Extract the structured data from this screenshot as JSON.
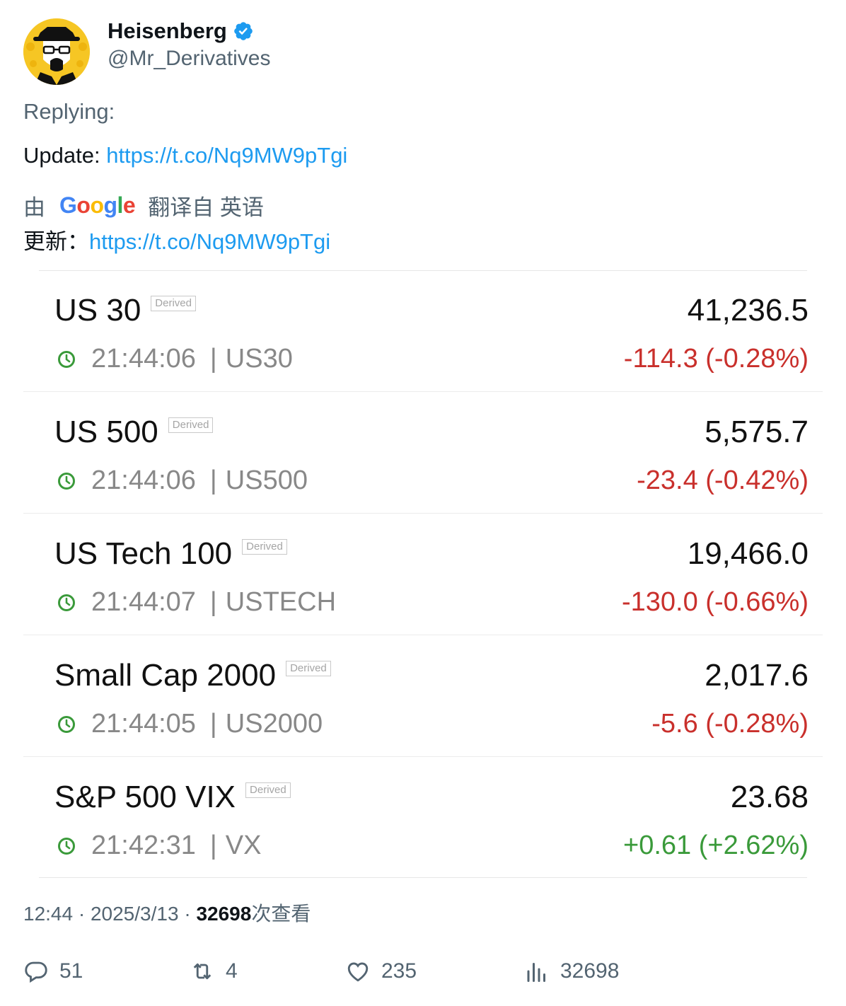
{
  "user": {
    "display_name": "Heisenberg",
    "handle": "@Mr_Derivatives"
  },
  "tweet": {
    "replying_label": "Replying:",
    "text_prefix": "Update: ",
    "text_link": "https://t.co/Nq9MW9pTgi",
    "translated_by_prefix": "由",
    "translated_by_suffix": "翻译自 英语",
    "translated_text_prefix": "更新：",
    "translated_text_link": "https://t.co/Nq9MW9pTgi"
  },
  "google_logo_letters": [
    "G",
    "o",
    "o",
    "g",
    "l",
    "e"
  ],
  "google_logo_colors": [
    "#4285F4",
    "#EA4335",
    "#FBBC05",
    "#4285F4",
    "#34A853",
    "#EA4335"
  ],
  "quotes": [
    {
      "name": "US 30",
      "badge": "Derived",
      "price": "41,236.5",
      "time": "21:44:06",
      "symbol": "US30",
      "change": "-114.3 (-0.28%)",
      "direction": "neg"
    },
    {
      "name": "US 500",
      "badge": "Derived",
      "price": "5,575.7",
      "time": "21:44:06",
      "symbol": "US500",
      "change": "-23.4 (-0.42%)",
      "direction": "neg"
    },
    {
      "name": "US Tech 100",
      "badge": "Derived",
      "price": "19,466.0",
      "time": "21:44:07",
      "symbol": "USTECH",
      "change": "-130.0 (-0.66%)",
      "direction": "neg"
    },
    {
      "name": "Small Cap 2000",
      "badge": "Derived",
      "price": "2,017.6",
      "time": "21:44:05",
      "symbol": "US2000",
      "change": "-5.6 (-0.28%)",
      "direction": "neg"
    },
    {
      "name": "S&P 500 VIX",
      "badge": "Derived",
      "price": "23.68",
      "time": "21:42:31",
      "symbol": "VX",
      "change": "+0.61 (+2.62%)",
      "direction": "pos"
    }
  ],
  "meta": {
    "time": "12:44",
    "separator": "·",
    "date": "2025/3/13",
    "views": "32698",
    "views_label": "次查看"
  },
  "actions": {
    "replies": "51",
    "retweets": "4",
    "likes": "235",
    "views": "32698"
  },
  "colors": {
    "link": "#1d9bf0",
    "negative": "#c9302c",
    "positive": "#3a9a3a",
    "verified": "#1d9bf0",
    "avatar_bg": "#f6c624"
  }
}
